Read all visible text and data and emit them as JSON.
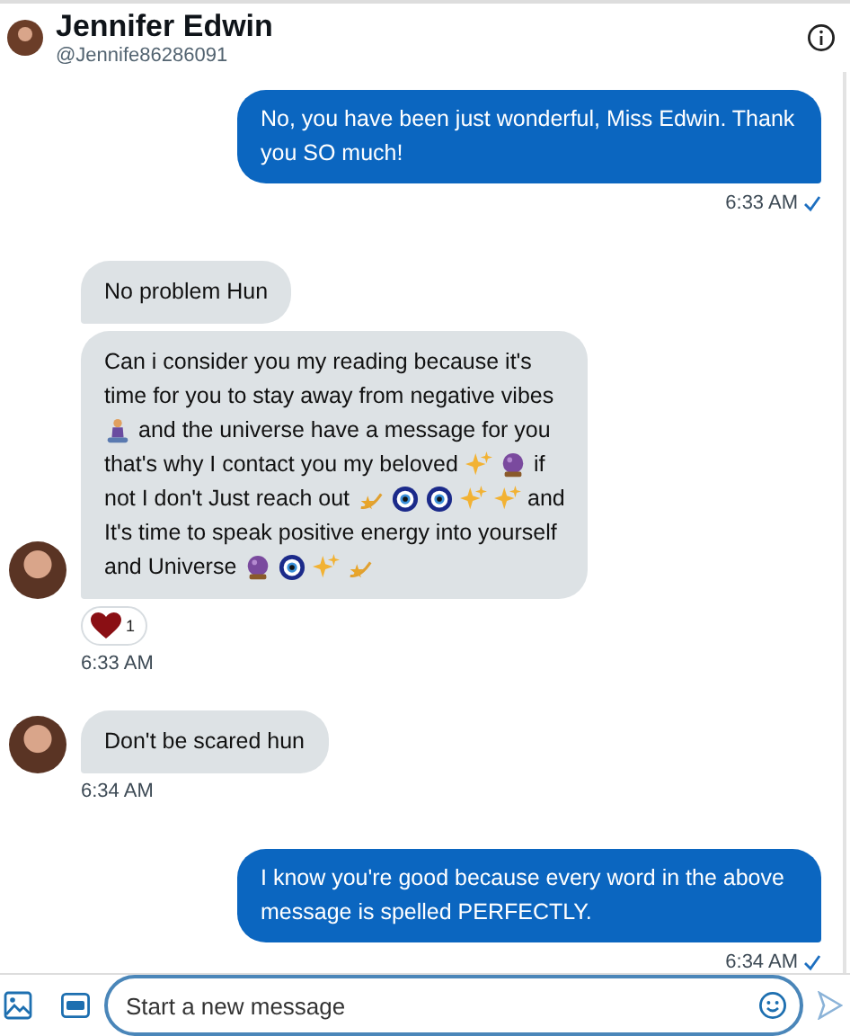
{
  "header": {
    "name": "Jennifer Edwin",
    "handle": "@Jennife86286091"
  },
  "messages": [
    {
      "kind": "sent",
      "text": "No, you have been just wonderful, Miss Edwin. Thank you SO much!",
      "time": "6:33 AM",
      "read": true
    },
    {
      "kind": "received",
      "avatar": false,
      "lines": [
        [
          {
            "kind": "text",
            "text": "No problem Hun"
          }
        ]
      ]
    },
    {
      "kind": "received",
      "avatar": true,
      "lines": [
        [
          {
            "kind": "text",
            "text": "Can i consider you my reading because it's"
          }
        ],
        [
          {
            "kind": "text",
            "text": "time for you to stay away from negative vibes"
          }
        ],
        [
          {
            "kind": "person"
          },
          {
            "kind": "text",
            "text": "and the universe have a message for you"
          }
        ],
        [
          {
            "kind": "text",
            "text": "that's why I contact you my beloved"
          },
          {
            "kind": "sparkles"
          },
          {
            "kind": "ball"
          },
          {
            "kind": "text",
            "text": "if"
          }
        ],
        [
          {
            "kind": "text",
            "text": "not I don't Just reach out"
          },
          {
            "kind": "star"
          },
          {
            "kind": "eye"
          },
          {
            "kind": "eye"
          },
          {
            "kind": "sparkles"
          },
          {
            "kind": "sparkles"
          },
          {
            "kind": "text",
            "text": "and"
          }
        ],
        [
          {
            "kind": "text",
            "text": "It's time to speak positive energy into yourself"
          }
        ],
        [
          {
            "kind": "text",
            "text": "and Universe"
          },
          {
            "kind": "ball"
          },
          {
            "kind": "eye"
          },
          {
            "kind": "sparkles"
          },
          {
            "kind": "star"
          }
        ]
      ],
      "reaction": {
        "count": "1"
      },
      "time": "6:33 AM"
    },
    {
      "kind": "received",
      "avatar": true,
      "lines": [
        [
          {
            "kind": "text",
            "text": "Don't be scared hun"
          }
        ]
      ],
      "time": "6:34 AM"
    },
    {
      "kind": "sent",
      "text": "I know you're good because every word in the above message is spelled PERFECTLY.",
      "time": "6:34 AM",
      "read": true
    }
  ],
  "composer": {
    "placeholder": "Start a new message"
  }
}
